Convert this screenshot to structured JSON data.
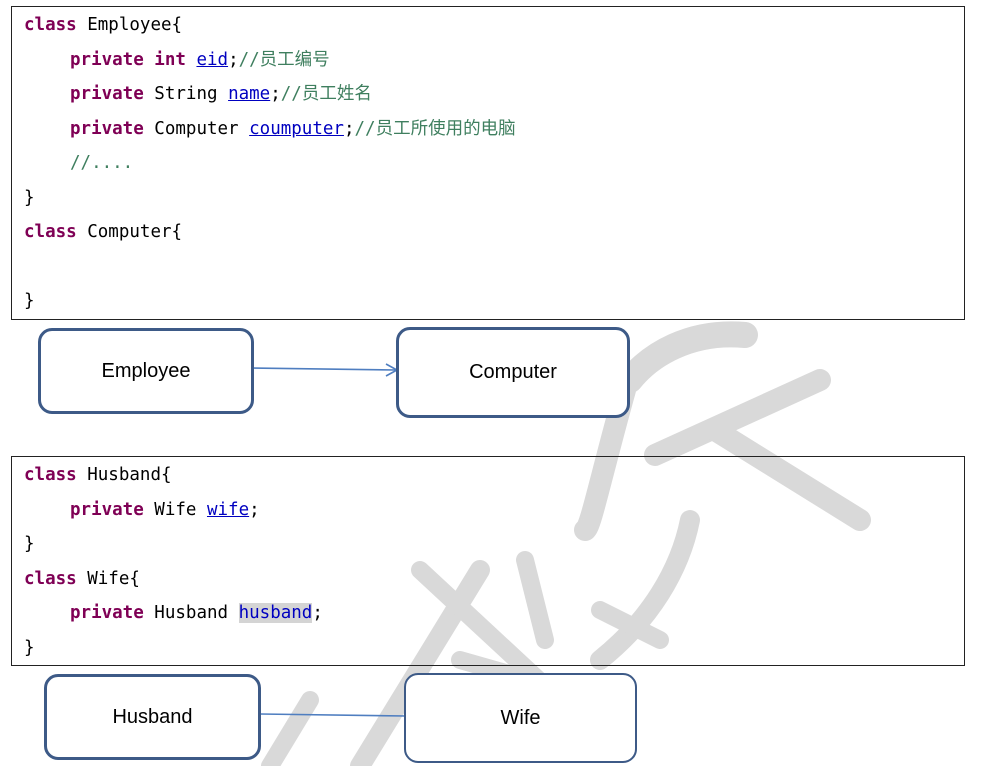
{
  "code_block_1": {
    "lines": [
      {
        "kw": "class",
        "text": " Employee{"
      },
      {
        "kw": "private",
        "type": " int ",
        "field": "eid",
        "tail": ";",
        "comment": "//员工编号"
      },
      {
        "kw": "private",
        "type": " String ",
        "field": "name",
        "tail": ";",
        "comment": "//员工姓名"
      },
      {
        "kw": "private",
        "type": " Computer ",
        "field": "coumputer",
        "tail": ";",
        "comment": "//员工所使用的电脑"
      },
      {
        "comment": "//...."
      },
      {
        "text": "}"
      },
      {
        "kw": "class",
        "text": " Computer{"
      },
      {
        "text": "}"
      }
    ]
  },
  "diagram_1": {
    "from": "Employee",
    "to": "Computer"
  },
  "code_block_2": {
    "lines": [
      {
        "kw": "class",
        "text": " Husband{"
      },
      {
        "kw": "private",
        "type": " Wife ",
        "field": "wife",
        "tail": ";"
      },
      {
        "text": "}"
      },
      {
        "kw": "class",
        "text": " Wife{"
      },
      {
        "kw": "private",
        "type": " Husband ",
        "field": "husband",
        "tail": ";"
      },
      {
        "text": "}"
      }
    ]
  },
  "diagram_2": {
    "left": "Husband",
    "right": "Wife"
  },
  "colors": {
    "keyword": "#7f0055",
    "field": "#0000c0",
    "comment": "#3f7f5f",
    "box_border": "#3d5a87",
    "arrow": "#4f7ec0",
    "watermark": "#d6d6d6"
  }
}
